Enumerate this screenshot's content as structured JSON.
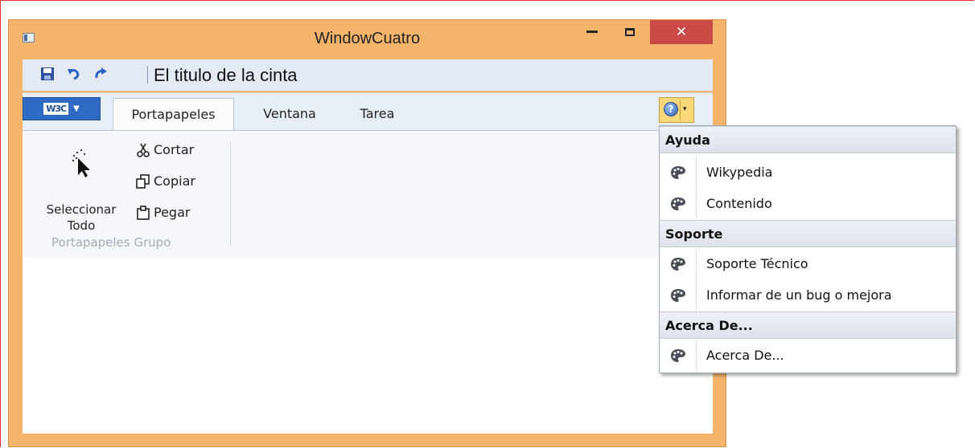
{
  "window": {
    "title": "WindowCuatro",
    "controls": {
      "minimize": "minimize",
      "maximize": "maximize",
      "close": "✕"
    }
  },
  "quick_access": {
    "icons": [
      "save-icon",
      "undo-icon",
      "redo-icon"
    ],
    "title": "El titulo de la cinta"
  },
  "ribbon": {
    "app_menu": {
      "logo": "W3C",
      "arrow": "▼"
    },
    "tabs": [
      {
        "label": "Portapapeles",
        "selected": true
      },
      {
        "label": "Ventana",
        "selected": false
      },
      {
        "label": "Tarea",
        "selected": false
      }
    ],
    "group": {
      "select_all_label_1": "Seleccionar",
      "select_all_label_2": "Todo",
      "cut": "Cortar",
      "copy": "Copiar",
      "paste": "Pegar",
      "group_label": "Portapapeles Grupo"
    },
    "help_button": {
      "glyph": "?",
      "arrow": "▾"
    }
  },
  "help_menu": {
    "sections": [
      {
        "header": "Ayuda",
        "items": [
          "Wikypedia",
          "Contenido"
        ]
      },
      {
        "header": "Soporte",
        "items": [
          "Soporte Técnico",
          "Informar de un bug o mejora"
        ]
      },
      {
        "header": "Acerca De...",
        "items": [
          "Acerca De..."
        ]
      }
    ]
  },
  "colors": {
    "window_frame": "#f4b46c",
    "close_button": "#c94a46",
    "app_menu_button": "#2f6bc4",
    "help_button": "#fbd97a"
  }
}
